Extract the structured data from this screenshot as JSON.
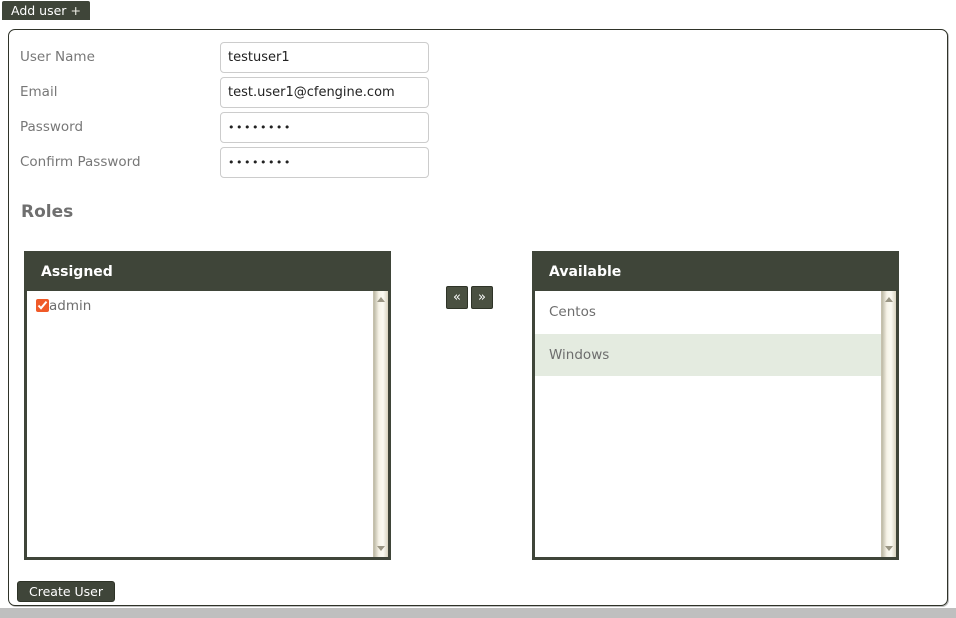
{
  "tab": {
    "label": "Add user",
    "plus": "+"
  },
  "form": {
    "fields": [
      {
        "label": "User Name",
        "value": "testuser1",
        "placeholder": "",
        "type": "text"
      },
      {
        "label": "Email",
        "value": "test.user1@cfengine.com",
        "placeholder": "",
        "type": "text"
      },
      {
        "label": "Password",
        "value": "••••••••",
        "placeholder": "",
        "type": "password"
      },
      {
        "label": "Confirm Password",
        "value": "••••••••",
        "placeholder": "",
        "type": "password"
      }
    ]
  },
  "roles": {
    "heading": "Roles",
    "assigned": {
      "header": "Assigned",
      "items": [
        {
          "label": "admin",
          "checked": true
        }
      ]
    },
    "available": {
      "header": "Available",
      "items": [
        {
          "label": "Centos",
          "highlighted": false
        },
        {
          "label": "Windows",
          "highlighted": true
        }
      ]
    },
    "transfer": {
      "move_left_label": "«",
      "move_right_label": "»"
    }
  },
  "actions": {
    "create_label": "Create User"
  },
  "colors": {
    "header_dark": "#3f4539",
    "checkbox_orange": "#f05a28",
    "row_highlight": "#e4ebe0",
    "label_gray": "#777777"
  }
}
